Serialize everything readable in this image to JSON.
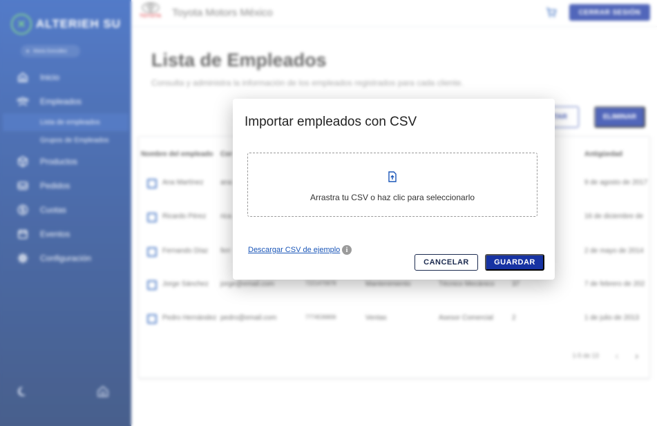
{
  "sidebar": {
    "brand": "ALTERIEH SU",
    "user_name": "Maria González",
    "items": [
      {
        "label": "Inicio",
        "icon": "home-icon"
      },
      {
        "label": "Empleados",
        "icon": "people-icon"
      },
      {
        "label": "Productos",
        "icon": "box-icon"
      },
      {
        "label": "Pedidos",
        "icon": "inbox-icon"
      },
      {
        "label": "Cuotas",
        "icon": "coin-icon"
      },
      {
        "label": "Eventos",
        "icon": "calendar-icon"
      },
      {
        "label": "Configuración",
        "icon": "gear-icon"
      }
    ],
    "subitems": [
      "Lista de empleados",
      "Grupos de Empleados"
    ],
    "active_subitem": "Lista de empleados"
  },
  "topbar": {
    "logo_text": "TOYOTA",
    "company": "Toyota Motors México",
    "logout_label": "CERRAR SESIÓN"
  },
  "main": {
    "title": "Lista de Empleados",
    "subtitle": "Consulta y administra la información de los empleados registrados para cada cliente.",
    "export_label_partial": "TAR",
    "delete_label": "ELIMINAR"
  },
  "table": {
    "headers": {
      "name": "Nombre del empleado",
      "email": "Cor",
      "seniority": "Antigüedad"
    },
    "rows": [
      {
        "name": "Ana Martínez",
        "email": "ana",
        "phone": "",
        "dept": "",
        "role": "",
        "num": "",
        "seniority": "9 de agosto de 2017"
      },
      {
        "name": "Ricardo Pérez",
        "email": "rica",
        "phone": "",
        "dept": "",
        "role": "",
        "num": "",
        "seniority": "16 de diciembre de"
      },
      {
        "name": "Fernando Díaz",
        "email": "ferr",
        "phone": "",
        "dept": "",
        "role": "",
        "num": "",
        "seniority": "2 de mayo de 2014"
      },
      {
        "name": "Jorge Sánchez",
        "email": "jorge@email.com",
        "phone": "7221470978",
        "dept": "Mantenimiento",
        "role": "Técnico Mecánico",
        "num": "37",
        "seniority": "7 de febrero de 202"
      },
      {
        "name": "Pedro Hernández",
        "email": "pedro@email.com",
        "phone": "7774536806",
        "dept": "Ventas",
        "role": "Asesor Comercial",
        "num": "2",
        "seniority": "1 de julio de 2013"
      }
    ],
    "pagination": "1-5 de 13"
  },
  "modal": {
    "title": "Importar empleados con CSV",
    "dropzone_text": "Arrastra tu CSV o haz clic para seleccionarlo",
    "sample_link": "Descargar CSV de ejemplo",
    "info_glyph": "i",
    "cancel_label": "CANCELAR",
    "save_label": "GUARDAR"
  },
  "colors": {
    "primary": "#1733a3",
    "sidebar_top": "#1a4fb6",
    "sidebar_bottom": "#0b2a66",
    "link": "#1a56b8"
  }
}
